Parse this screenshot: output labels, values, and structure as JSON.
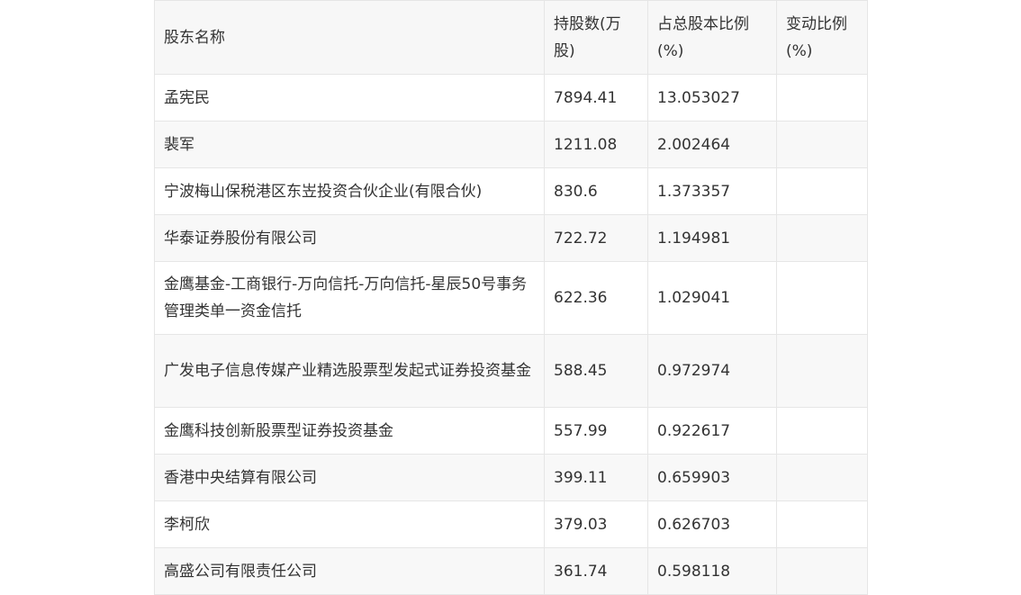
{
  "table": {
    "headers": [
      "股东名称",
      "持股数(万股)",
      "占总股本比例(%)",
      "变动比例(%)"
    ],
    "rows": [
      [
        "孟宪民",
        "7894.41",
        "13.053027",
        ""
      ],
      [
        "裴军",
        "1211.08",
        "2.002464",
        ""
      ],
      [
        "宁波梅山保税港区东岦投资合伙企业(有限合伙)",
        "830.6",
        "1.373357",
        ""
      ],
      [
        "华泰证券股份有限公司",
        "722.72",
        "1.194981",
        ""
      ],
      [
        "金鹰基金-工商银行-万向信托-万向信托-星辰50号事务管理类单一资金信托",
        "622.36",
        "1.029041",
        ""
      ],
      [
        "广发电子信息传媒产业精选股票型发起式证券投资基金",
        "588.45",
        "0.972974",
        ""
      ],
      [
        "金鹰科技创新股票型证券投资基金",
        "557.99",
        "0.922617",
        ""
      ],
      [
        "香港中央结算有限公司",
        "399.11",
        "0.659903",
        ""
      ],
      [
        "李柯欣",
        "379.03",
        "0.626703",
        ""
      ],
      [
        "高盛公司有限责任公司",
        "361.74",
        "0.598118",
        ""
      ]
    ]
  }
}
